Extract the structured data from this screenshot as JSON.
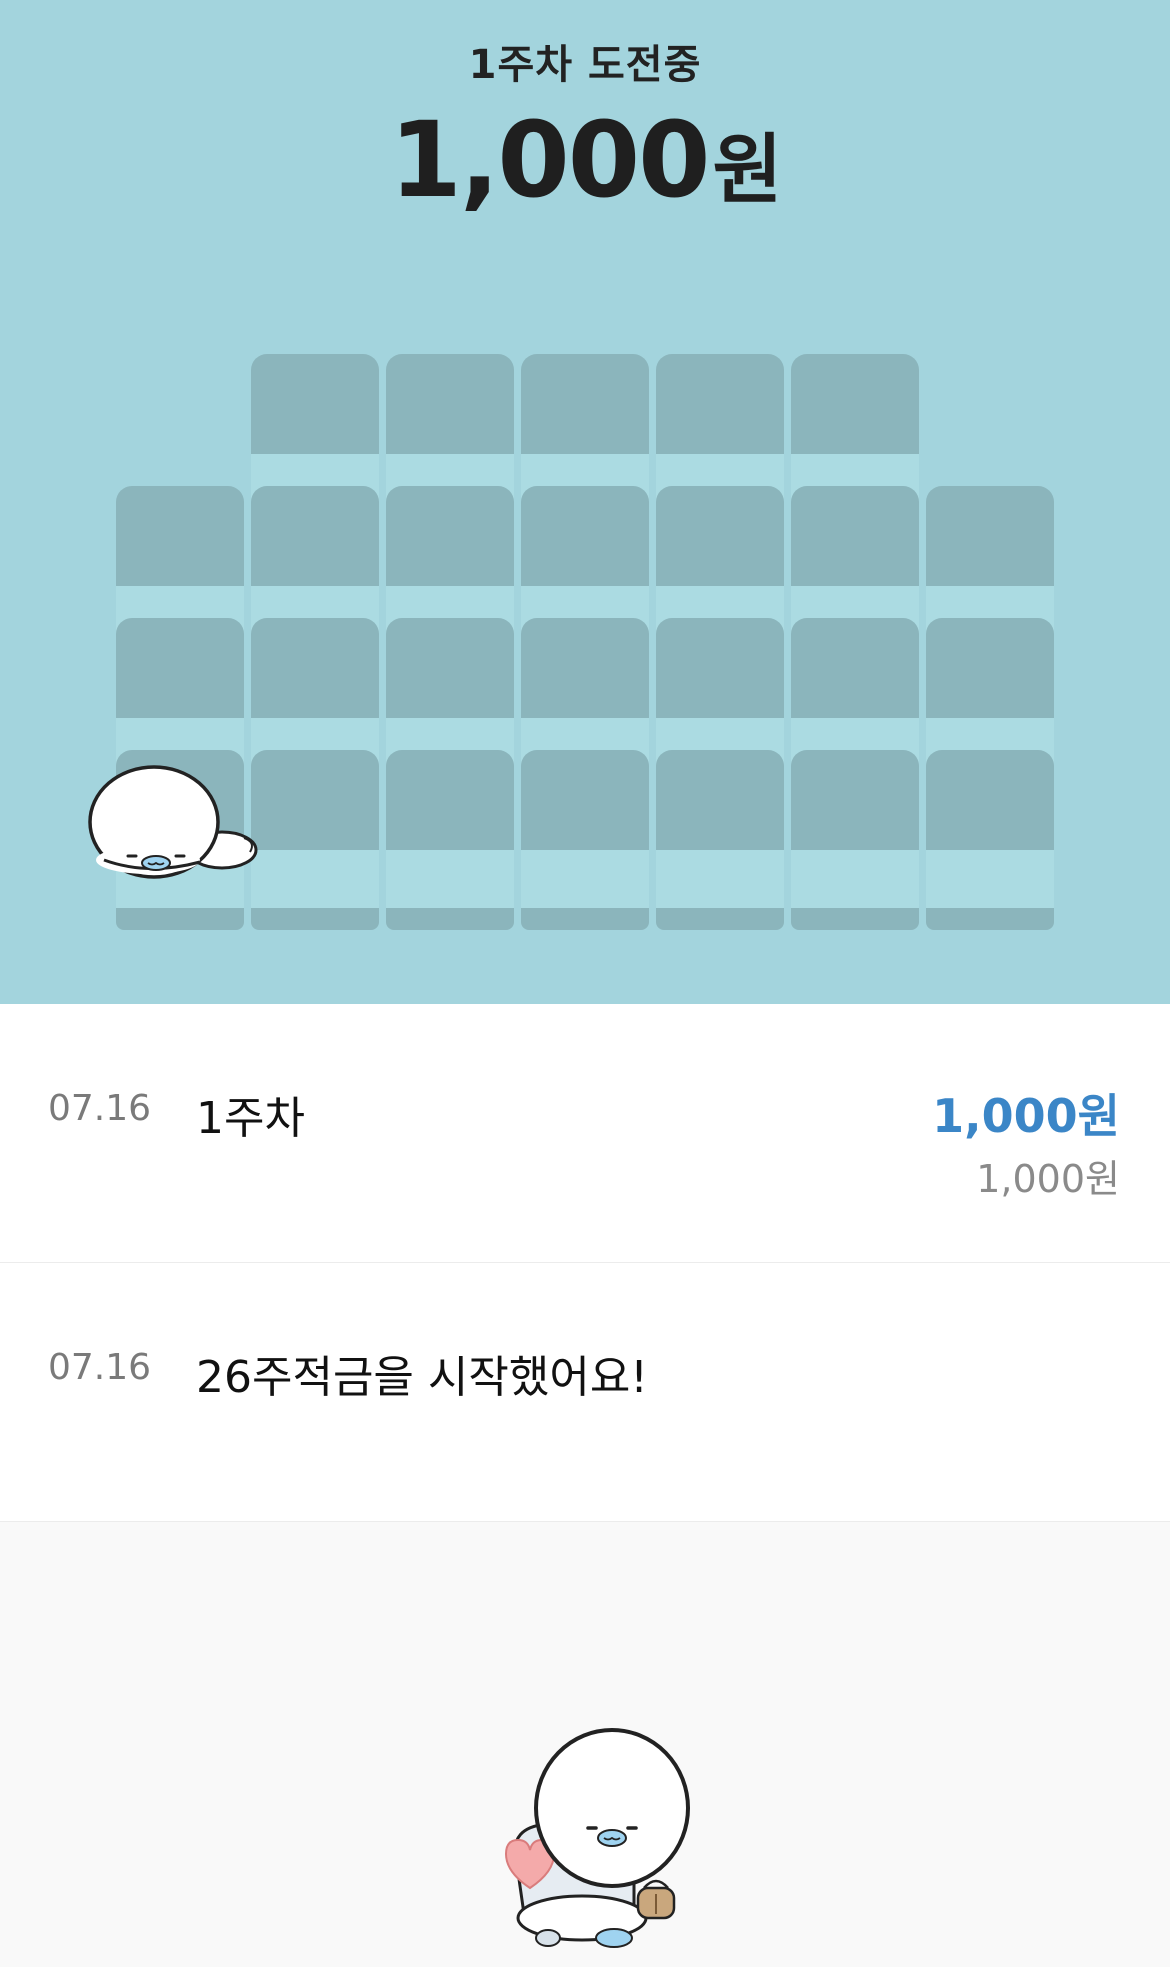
{
  "header": {
    "week_status": "1주차 도전중",
    "total_amount": "1,000",
    "total_unit": "원"
  },
  "seat_grid": {
    "rows": [
      {
        "filled": [
          false,
          true,
          true,
          true,
          true,
          true,
          false
        ]
      },
      {
        "filled": [
          true,
          true,
          true,
          true,
          true,
          true,
          true
        ]
      },
      {
        "filled": [
          true,
          true,
          true,
          true,
          true,
          true,
          true
        ]
      },
      {
        "filled": [
          true,
          true,
          true,
          true,
          true,
          true,
          true
        ]
      }
    ]
  },
  "history": [
    {
      "date": "07.16",
      "title": "1주차",
      "amount": "1,000원",
      "sub_amount": "1,000원"
    },
    {
      "date": "07.16",
      "title": "26주적금을 시작했어요!",
      "amount": "",
      "sub_amount": ""
    }
  ],
  "colors": {
    "hero_bg": "#a3d4dd",
    "seat_back": "#8bb5bc",
    "seat_cushion": "#abdbe2",
    "accent_blue": "#3b86c7"
  },
  "icons": {
    "mascot_lying": "seal-mascot-lying-icon",
    "mascot_bottom": "seal-mascot-with-heart-icon"
  }
}
